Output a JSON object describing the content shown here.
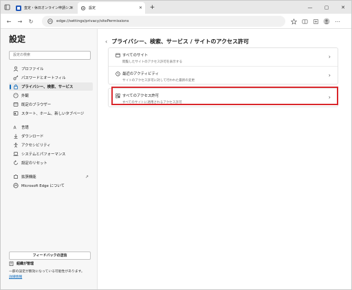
{
  "tabs": [
    {
      "label": "査定・休日オンライン申請システム",
      "active": false
    },
    {
      "label": "設定",
      "active": true
    }
  ],
  "address": {
    "url": "edge://settings/privacy/sitePermissions"
  },
  "sidebar": {
    "title": "設定",
    "search_placeholder": "設定の検索",
    "items": [
      {
        "label": "プロファイル",
        "icon": "person-icon"
      },
      {
        "label": "パスワードとオートフィル",
        "icon": "key-icon"
      },
      {
        "label": "プライバシー、検索、サービス",
        "icon": "lock-icon",
        "active": true
      },
      {
        "label": "外観",
        "icon": "palette-icon"
      },
      {
        "label": "既定のブラウザー",
        "icon": "browser-icon"
      },
      {
        "label": "スタート、ホーム、新しいタブページ",
        "icon": "home-icon"
      },
      {
        "label": "言語",
        "icon": "language-icon"
      },
      {
        "label": "ダウンロード",
        "icon": "download-icon"
      },
      {
        "label": "アクセシビリティ",
        "icon": "accessibility-icon"
      },
      {
        "label": "システムとパフォーマンス",
        "icon": "laptop-icon"
      },
      {
        "label": "設定のリセット",
        "icon": "reset-icon"
      },
      {
        "label": "拡張機能",
        "icon": "puzzle-icon",
        "external": true
      },
      {
        "label": "Microsoft Edge について",
        "icon": "edge-icon"
      }
    ],
    "feedback_button": "フィードバックの送信",
    "managed_label": "組織が管理",
    "managed_note": "一部の設定が無効になっている可能性があります。",
    "details_link": "詳細情報"
  },
  "main": {
    "page_title": "プライバシー、検索、サービス / サイトのアクセス許可",
    "rows": [
      {
        "title": "すべてのサイト",
        "desc": "閲覧したサイトのアクセス許可を表示する",
        "icon": "sites-icon"
      },
      {
        "title": "最近のアクティビティ",
        "desc": "サイトのアクセス許可に対して行われた最新の変更",
        "icon": "clock-icon"
      },
      {
        "title": "すべてのアクセス許可",
        "desc": "すべてのサイトに適用されるアクセス許可",
        "icon": "permissions-icon"
      }
    ]
  },
  "colors": {
    "accent": "#0f6cbd",
    "highlight": "#d9262b"
  }
}
